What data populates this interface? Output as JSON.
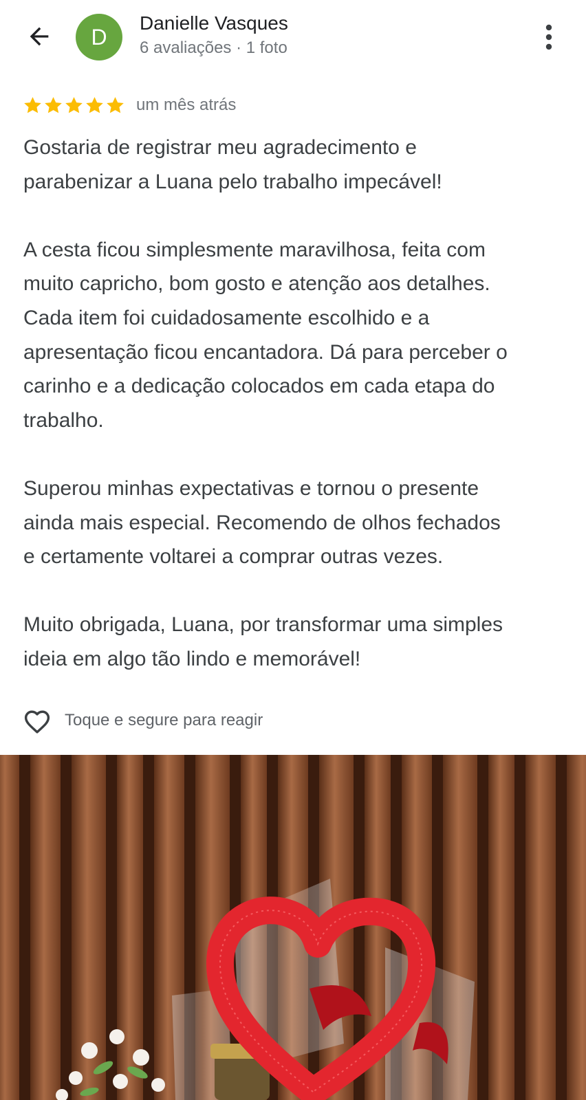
{
  "header": {
    "back_icon": "arrow-back-icon",
    "avatar_letter": "D",
    "avatar_color": "#67a63f",
    "reviewer_name": "Danielle Vasques",
    "reviewer_meta": "6 avaliações · 1 foto",
    "more_icon": "more-vert-icon"
  },
  "review": {
    "rating": 5,
    "rating_max": 5,
    "star_color": "#fbbc04",
    "date": "um mês atrás",
    "paragraphs": [
      "Gostaria de registrar meu agradecimento e\nparabenizar a Luana pelo trabalho impecável!",
      "A cesta ficou simplesmente maravilhosa, feita com\nmuito capricho, bom gosto e atenção aos detalhes.\nCada item foi cuidadosamente escolhido e a\napresentação ficou encantadora. Dá para perceber o\ncarinho e a dedicação colocados em cada etapa do\ntrabalho.",
      "Superou minhas expectativas e tornou o presente\nainda mais especial. Recomendo de olhos fechados\ne certamente voltarei a comprar outras vezes.",
      "Muito obrigada, Luana, por transformar uma simples\nideia em algo tão lindo e memorável!"
    ]
  },
  "reaction": {
    "icon": "heart-outline-icon",
    "label": "Toque e segure para reagir"
  },
  "photo": {
    "subject": "gift-basket-photo"
  }
}
